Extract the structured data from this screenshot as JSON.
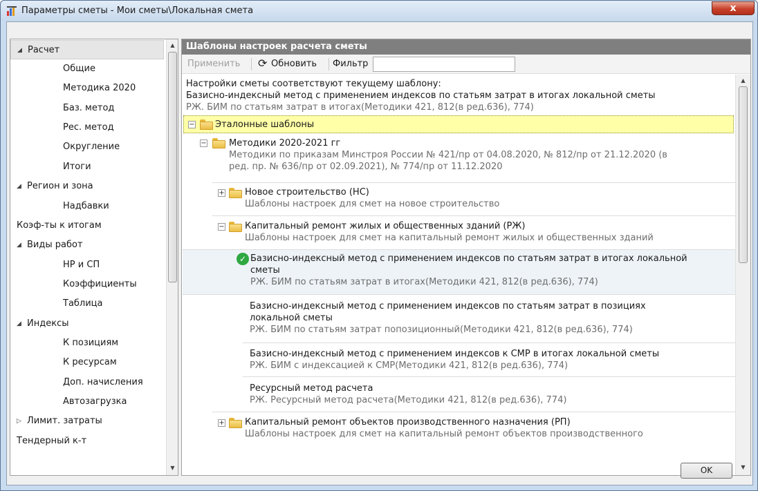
{
  "window": {
    "title": "Параметры сметы - Мои сметы\\Локальная смета",
    "close_glyph": "x"
  },
  "sidebar": {
    "items": [
      {
        "label": "Расчет",
        "arrow": "◢"
      },
      {
        "label": "Общие"
      },
      {
        "label": "Методика 2020"
      },
      {
        "label": "Баз. метод"
      },
      {
        "label": "Рес. метод"
      },
      {
        "label": "Округление"
      },
      {
        "label": "Итоги"
      },
      {
        "label": "Регион и зона",
        "arrow": "◢"
      },
      {
        "label": "Надбавки"
      },
      {
        "label": "Коэф-ты к итогам"
      },
      {
        "label": "Виды работ",
        "arrow": "◢"
      },
      {
        "label": "НР и СП"
      },
      {
        "label": "Коэффициенты"
      },
      {
        "label": "Таблица"
      },
      {
        "label": "Индексы",
        "arrow": "◢"
      },
      {
        "label": "К позициям"
      },
      {
        "label": "К ресурсам"
      },
      {
        "label": "Доп. начисления"
      },
      {
        "label": "Автозагрузка"
      },
      {
        "label": "Лимит. затраты",
        "arrow": "▷"
      },
      {
        "label": "Тендерный к-т"
      }
    ]
  },
  "panel": {
    "header": "Шаблоны настроек расчета сметы",
    "toolbar": {
      "apply_label": "Применить",
      "refresh_label": "Обновить",
      "filter_label": "Фильтр",
      "filter_value": ""
    }
  },
  "status": {
    "line1": "Настройки сметы соответствуют текущему шаблону:",
    "line2": "Базисно-индексный метод с применением индексов по статьям затрат в итогах локальной сметы",
    "line3": "РЖ. БИМ по статьям затрат в итогах(Методики 421, 812(в ред.636), 774)"
  },
  "tree": {
    "root": {
      "label": "Эталонные шаблоны",
      "expander": "−"
    },
    "methods": {
      "label": "Методики 2020-2021 гг",
      "desc1": "Методики по приказам Минстроя России № 421/пр от 04.08.2020, № 812/пр от 21.12.2020 (в",
      "desc2": "ред. пр. № 636/пр от 02.09.2021), № 774/пр от 11.12.2020",
      "expander": "−"
    },
    "ns": {
      "label": "Новое строительство (НС)",
      "desc": "Шаблоны настроек для смет на новое строительство",
      "expander": "+"
    },
    "rzh": {
      "label": "Капитальный ремонт жилых и общественных зданий (РЖ)",
      "desc": "Шаблоны настроек для смет на капитальный ремонт жилых и общественных зданий",
      "expander": "−"
    },
    "templates": [
      {
        "title1": "Базисно-индексный метод с применением индексов по статьям затрат в итогах локальной",
        "title2": "сметы",
        "desc": "РЖ. БИМ по статьям затрат в итогах(Методики 421, 812(в ред.636), 774)",
        "active": true
      },
      {
        "title1": "Базисно-индексный метод с применением индексов по статьям затрат в позициях",
        "title2": "локальной сметы",
        "desc": "РЖ. БИМ по статьям затрат попозиционный(Методики 421, 812(в ред.636), 774)"
      },
      {
        "title1": "Базисно-индексный метод с применением индексов к СМР в итогах локальной сметы",
        "title2": "",
        "desc": "РЖ. БИМ с индексацией к СМР(Методики 421, 812(в ред.636), 774)"
      },
      {
        "title1": "Ресурсный метод расчета",
        "title2": "",
        "desc": "РЖ. Ресурсный метод расчета(Методики 421, 812(в ред.636), 774)"
      }
    ],
    "rp": {
      "label": "Капитальный ремонт объектов производственного назначения (РП)",
      "desc": "Шаблоны настроек для смет на капитальный ремонт объектов производственного",
      "expander": "+"
    }
  },
  "footer": {
    "ok_label": "OK"
  },
  "colors": {
    "header_bg": "#7f7f7f",
    "root_highlight": "#ffffa8",
    "active_row": "#eef3f7",
    "check": "#2fa842"
  }
}
